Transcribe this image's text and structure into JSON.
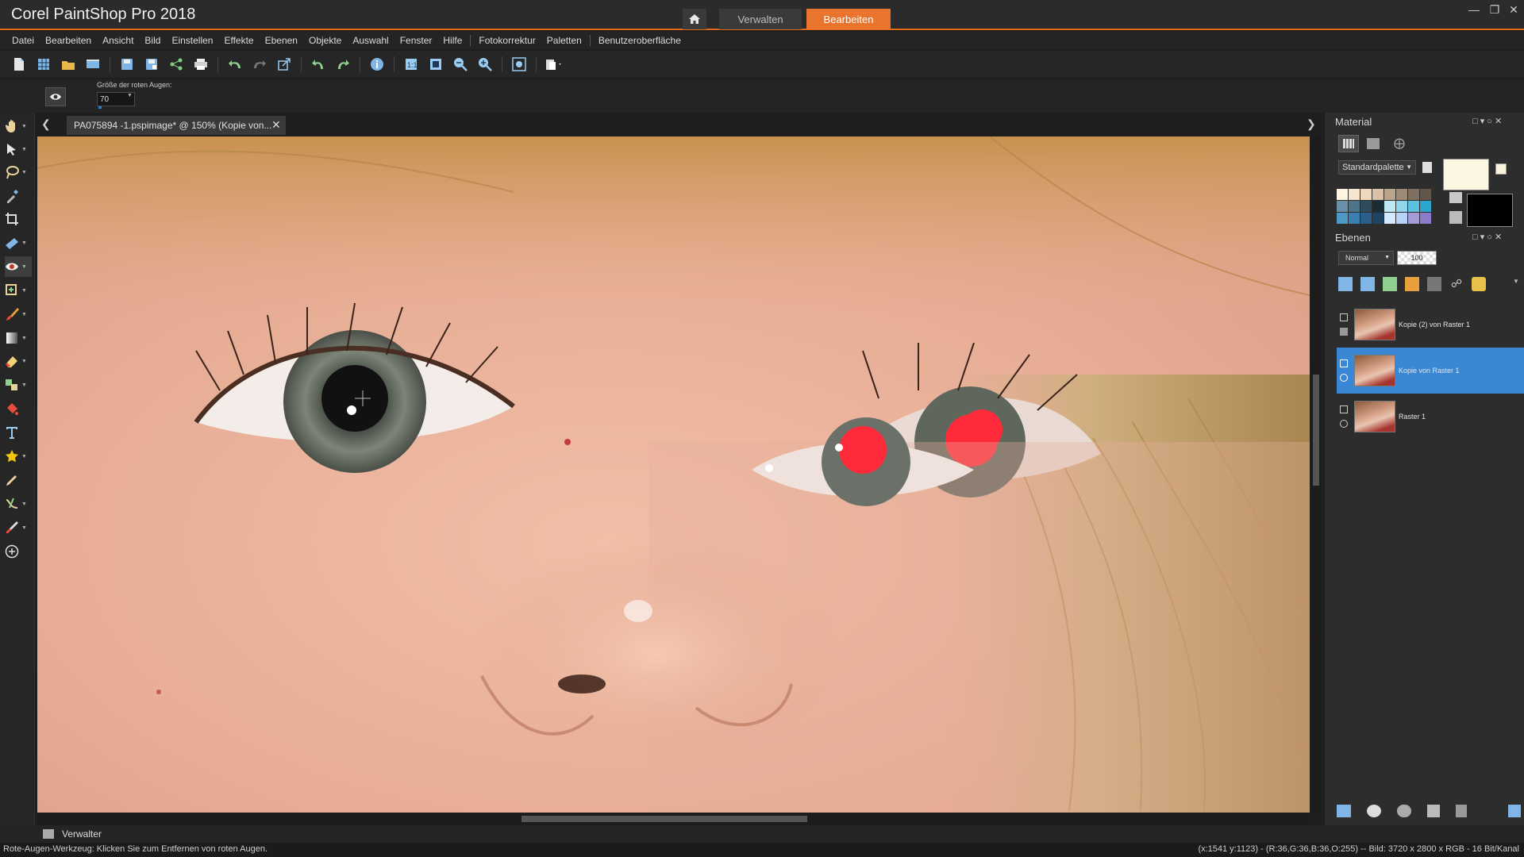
{
  "app": {
    "title": "Corel PaintShop Pro 2018",
    "workspace_tabs": [
      "Verwalten",
      "Bearbeiten"
    ],
    "active_workspace": "Bearbeiten",
    "accent_color": "#e9742d"
  },
  "menu": [
    "Datei",
    "Bearbeiten",
    "Ansicht",
    "Bild",
    "Einstellen",
    "Effekte",
    "Ebenen",
    "Objekte",
    "Auswahl",
    "Fenster",
    "Hilfe",
    "Fotokorrektur",
    "Paletten",
    "Benutzeroberfläche"
  ],
  "toolbar_icons": [
    "new-file-icon",
    "grid-icon",
    "open-folder-icon",
    "scan-icon",
    "save-icon",
    "save-as-icon",
    "share-icon",
    "print-icon",
    "undo-icon",
    "redo-icon",
    "resize-icon",
    "rotate-left-icon",
    "rotate-right-icon",
    "info-icon",
    "zoom-actual-icon",
    "fit-window-icon",
    "zoom-out-icon",
    "zoom-in-icon",
    "zoom-fit-icon",
    "paste-icon"
  ],
  "options": {
    "label": "Größe der roten Augen:",
    "value": "70"
  },
  "tools": [
    "pan-tool-icon",
    "pick-tool-icon",
    "lasso-tool-icon",
    "dropper-tool-icon",
    "crop-tool-icon",
    "straighten-tool-icon",
    "red-eye-tool-icon",
    "makeover-tool-icon",
    "paint-brush-tool-icon",
    "gradient-tool-icon",
    "eraser-tool-icon",
    "clone-tool-icon",
    "paint-fill-tool-icon",
    "text-tool-icon",
    "preset-shape-tool-icon",
    "pen-tool-icon",
    "warp-brush-tool-icon",
    "color-replacer-tool-icon",
    "add-tool-icon"
  ],
  "document_tab": {
    "title": "PA075894 -1.pspimage* @ 150% (Kopie von..."
  },
  "material_panel": {
    "title": "Material",
    "palette_select": "Standardpalette",
    "foreground_color": "#fbf7e2",
    "background_color": "#000000"
  },
  "layers_panel": {
    "title": "Ebenen",
    "blend_mode": "Normal",
    "opacity": "100",
    "layers": [
      {
        "name": "Kopie (2) von Raster 1",
        "selected": false
      },
      {
        "name": "Kopie von Raster 1",
        "selected": true
      },
      {
        "name": "Raster 1",
        "selected": false
      }
    ]
  },
  "manager_bar": {
    "label": "Verwalter"
  },
  "status": {
    "left": "Rote-Augen-Werkzeug: Klicken Sie zum Entfernen von roten Augen.",
    "right": "(x:1541 y:1123) - (R:36,G:36,B:36,O:255) -- Bild:  3720 x 2800 x RGB - 16 Bit/Kanal"
  }
}
